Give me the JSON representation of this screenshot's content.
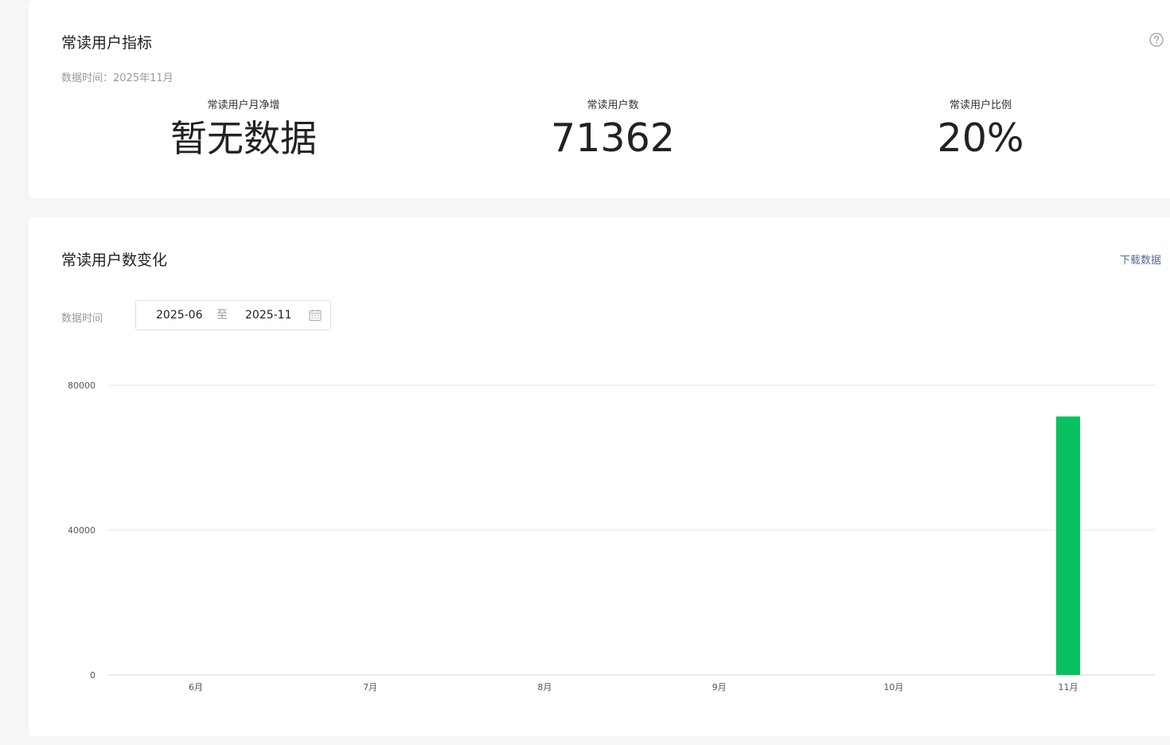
{
  "metrics_card": {
    "title": "常读用户指标",
    "data_time": "数据时间：2025年11月",
    "help_icon": "question-circle-icon",
    "metrics": [
      {
        "label": "常读用户月净增",
        "value": "暂无数据"
      },
      {
        "label": "常读用户数",
        "value": "71362"
      },
      {
        "label": "常读用户比例",
        "value": "20%"
      }
    ]
  },
  "trend_card": {
    "title": "常读用户数变化",
    "download_label": "下载数据",
    "range_label": "数据时间",
    "range_start": "2025-06",
    "range_separator": "至",
    "range_end": "2025-11",
    "calendar_icon": "calendar-icon"
  },
  "colors": {
    "bar": "#07c160",
    "link": "#576b95",
    "grid": "#e6e6e6"
  },
  "chart_data": {
    "type": "bar",
    "categories": [
      "6月",
      "7月",
      "8月",
      "9月",
      "10月",
      "11月"
    ],
    "values": [
      0,
      0,
      0,
      0,
      0,
      71362
    ],
    "ylim": [
      0,
      80000
    ],
    "yticks": [
      "0",
      "40000",
      "80000"
    ],
    "title": "",
    "xlabel": "",
    "ylabel": "",
    "grid": true
  }
}
